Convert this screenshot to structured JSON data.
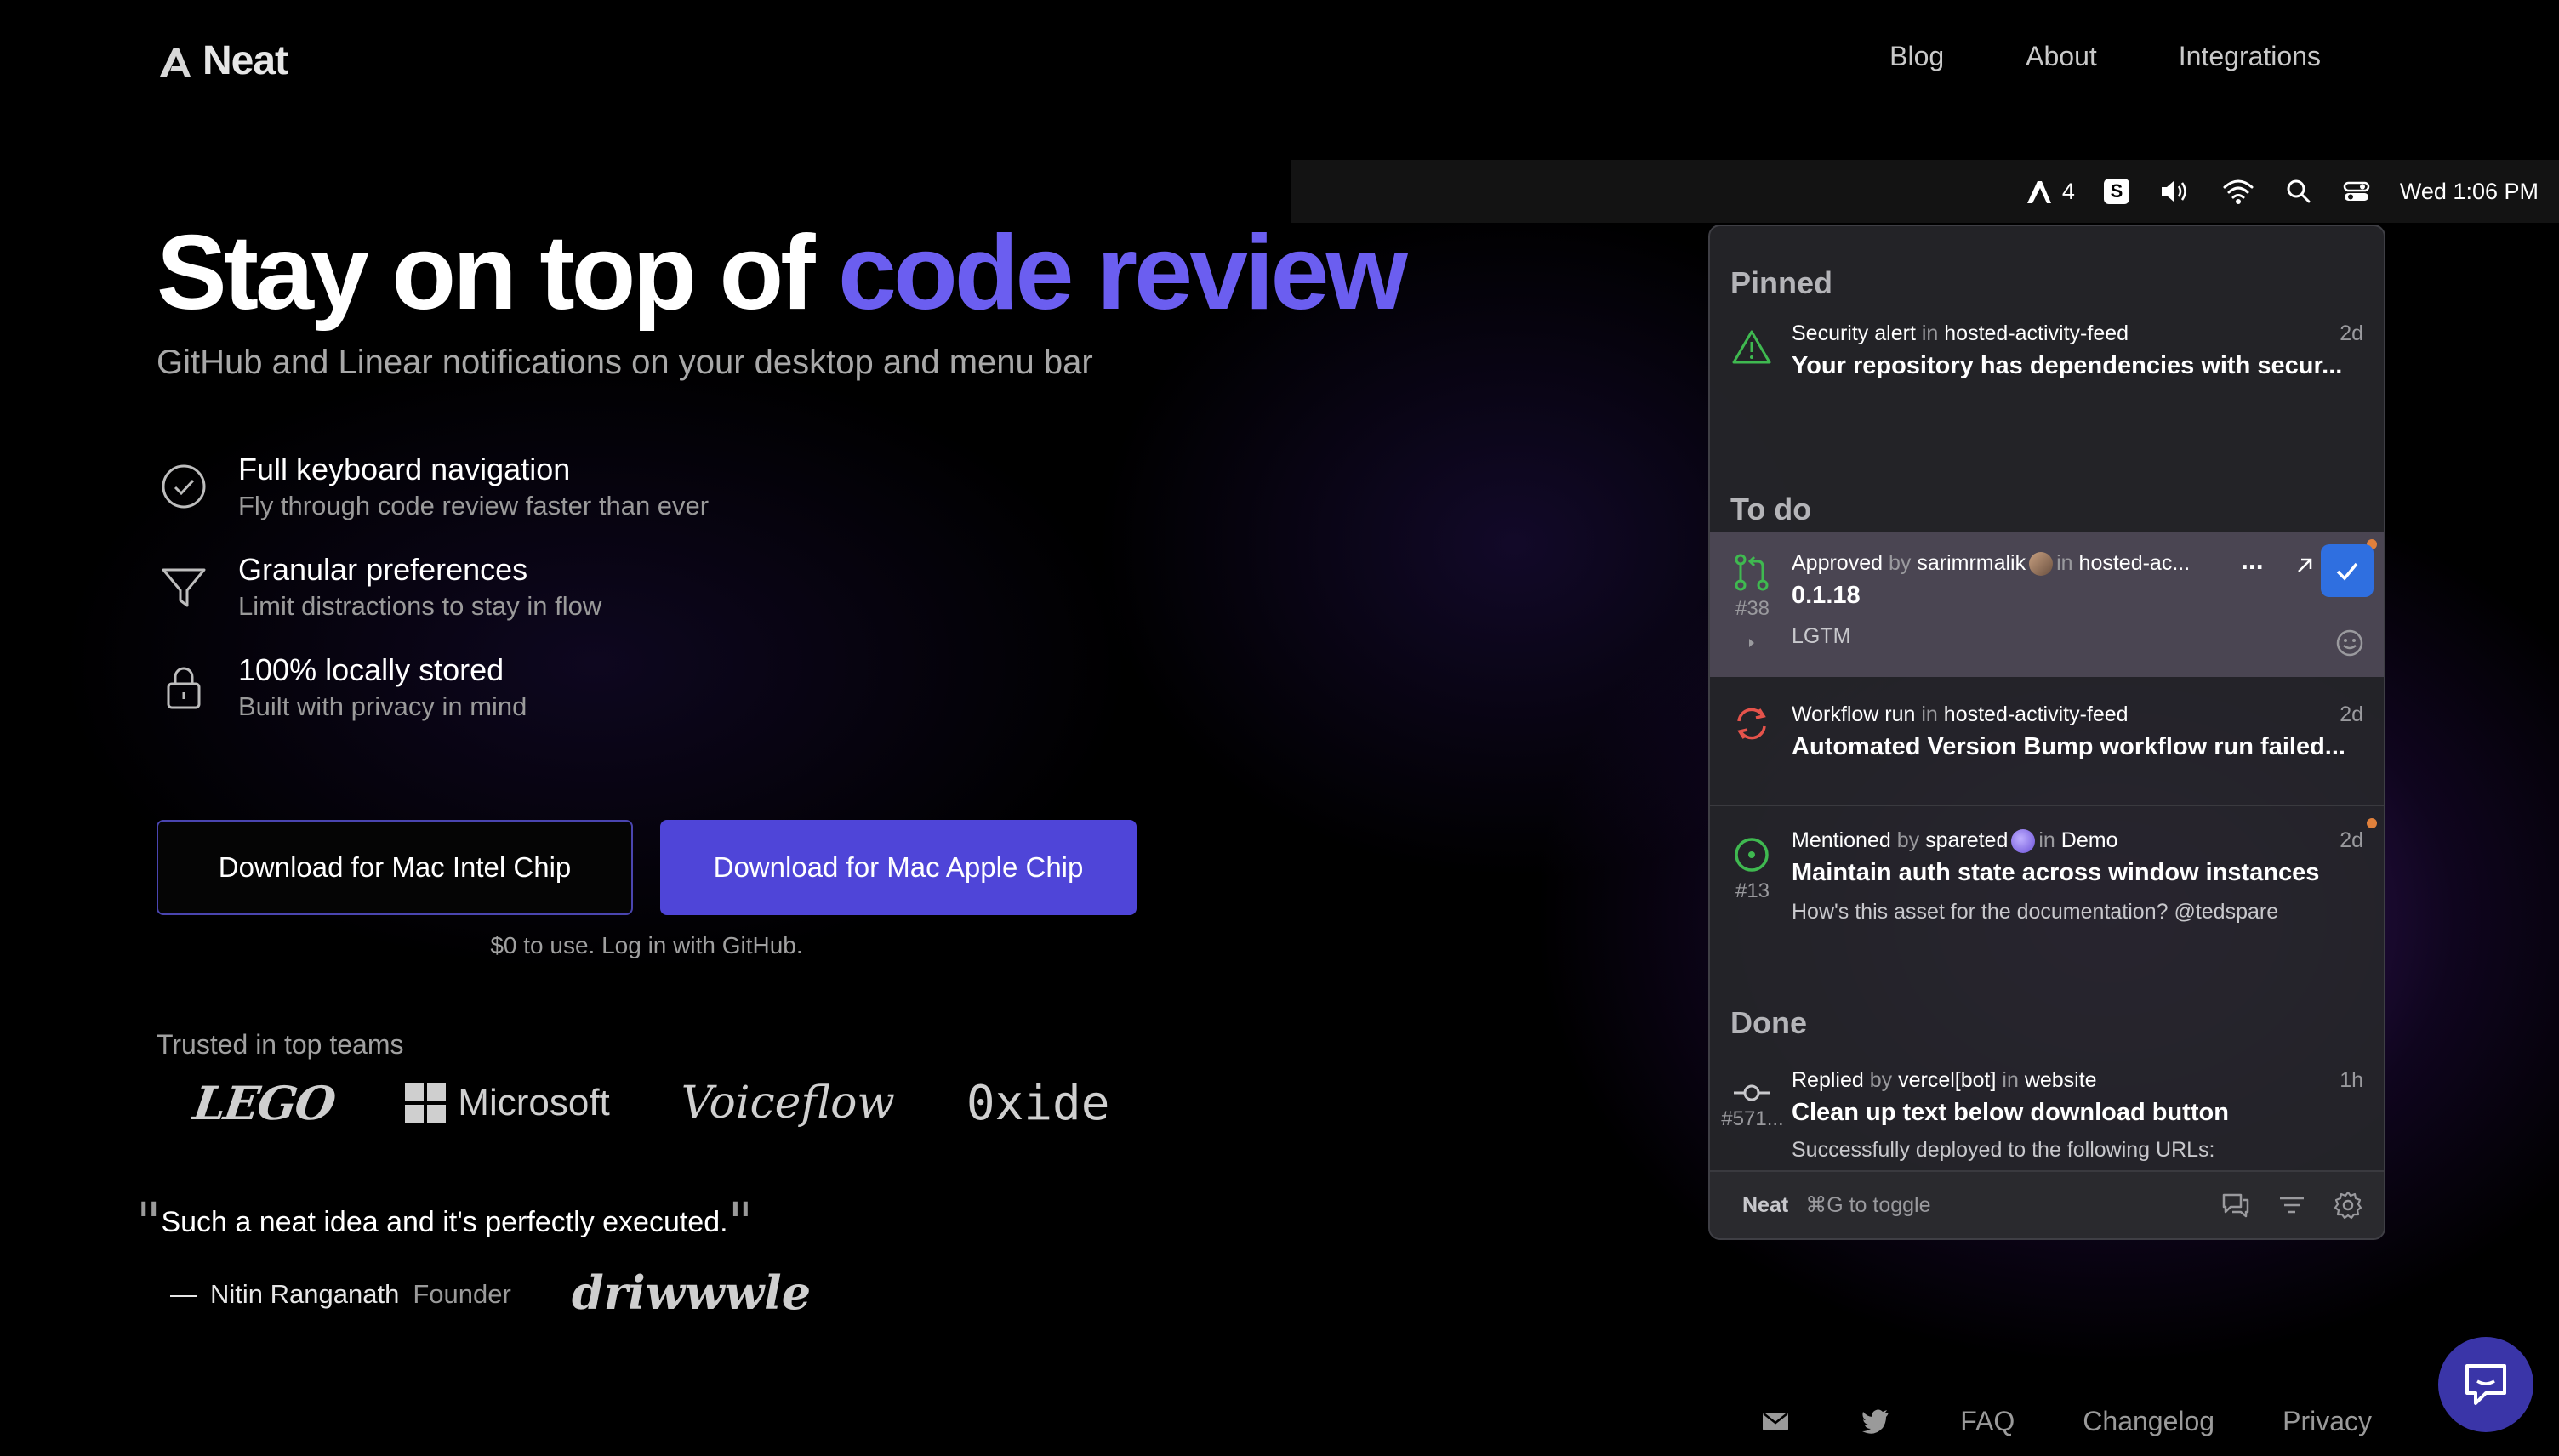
{
  "brand": {
    "name": "Neat"
  },
  "nav": {
    "links": [
      "Blog",
      "About",
      "Integrations"
    ]
  },
  "hero": {
    "title_prefix": "Stay on top of ",
    "title_accent": "code review",
    "subtitle": "GitHub and Linear notifications on your desktop and menu bar",
    "accent_color": "#6b5ef0"
  },
  "features": [
    {
      "icon": "check-circle-icon",
      "title": "Full keyboard navigation",
      "desc": "Fly through code review faster than ever"
    },
    {
      "icon": "filter-icon",
      "title": "Granular preferences",
      "desc": "Limit distractions to stay in flow"
    },
    {
      "icon": "lock-icon",
      "title": "100% locally stored",
      "desc": "Built with privacy in mind"
    }
  ],
  "cta": {
    "intel_label": "Download for Mac Intel Chip",
    "apple_label": "Download for Mac Apple Chip",
    "price_note": "$0 to use. Log in with GitHub."
  },
  "trusted": {
    "label": "Trusted in top teams",
    "logos": [
      "LEGO",
      "Microsoft",
      "Voiceflow",
      "0xide"
    ]
  },
  "testimonial": {
    "quote": "Such a neat idea and it's perfectly executed.",
    "dash": "—",
    "author": "Nitin Ranganath",
    "role": "Founder",
    "company": "driwwwle"
  },
  "menubar": {
    "neat_count": "4",
    "s_badge": "S",
    "clock": "Wed 1:06 PM"
  },
  "panel": {
    "pinned_header": "Pinned",
    "todo_header": "To do",
    "done_header": "Done",
    "pinned": {
      "kind": "Security alert",
      "in": "in",
      "repo": "hosted-activity-feed",
      "time": "2d",
      "title": "Your repository has dependencies with secur..."
    },
    "todo": [
      {
        "kind": "Approved",
        "by": "by",
        "user": "sarimrmalik",
        "in": "in",
        "repo": "hosted-ac...",
        "number": "#38",
        "title": "0.1.18",
        "body": "LGTM"
      },
      {
        "kind": "Workflow run",
        "in": "in",
        "repo": "hosted-activity-feed",
        "time": "2d",
        "title": "Automated Version Bump workflow run failed..."
      },
      {
        "kind": "Mentioned",
        "by": "by",
        "user": "spareted",
        "in": "in",
        "repo": "Demo",
        "time": "2d",
        "number": "#13",
        "title": "Maintain auth state across window instances",
        "body": "How's this asset for the documentation? @tedspare"
      }
    ],
    "done": [
      {
        "kind": "Replied",
        "by": "by",
        "user": "vercel[bot]",
        "in": "in",
        "repo": "website",
        "time": "1h",
        "number": "#571...",
        "title": "Clean up text below download button",
        "body": "Successfully deployed to the following URLs:"
      }
    ],
    "footer": {
      "app": "Neat",
      "hint": "⌘G to toggle"
    },
    "more": "..."
  },
  "bottom": {
    "links": [
      "FAQ",
      "Changelog",
      "Privacy"
    ]
  }
}
